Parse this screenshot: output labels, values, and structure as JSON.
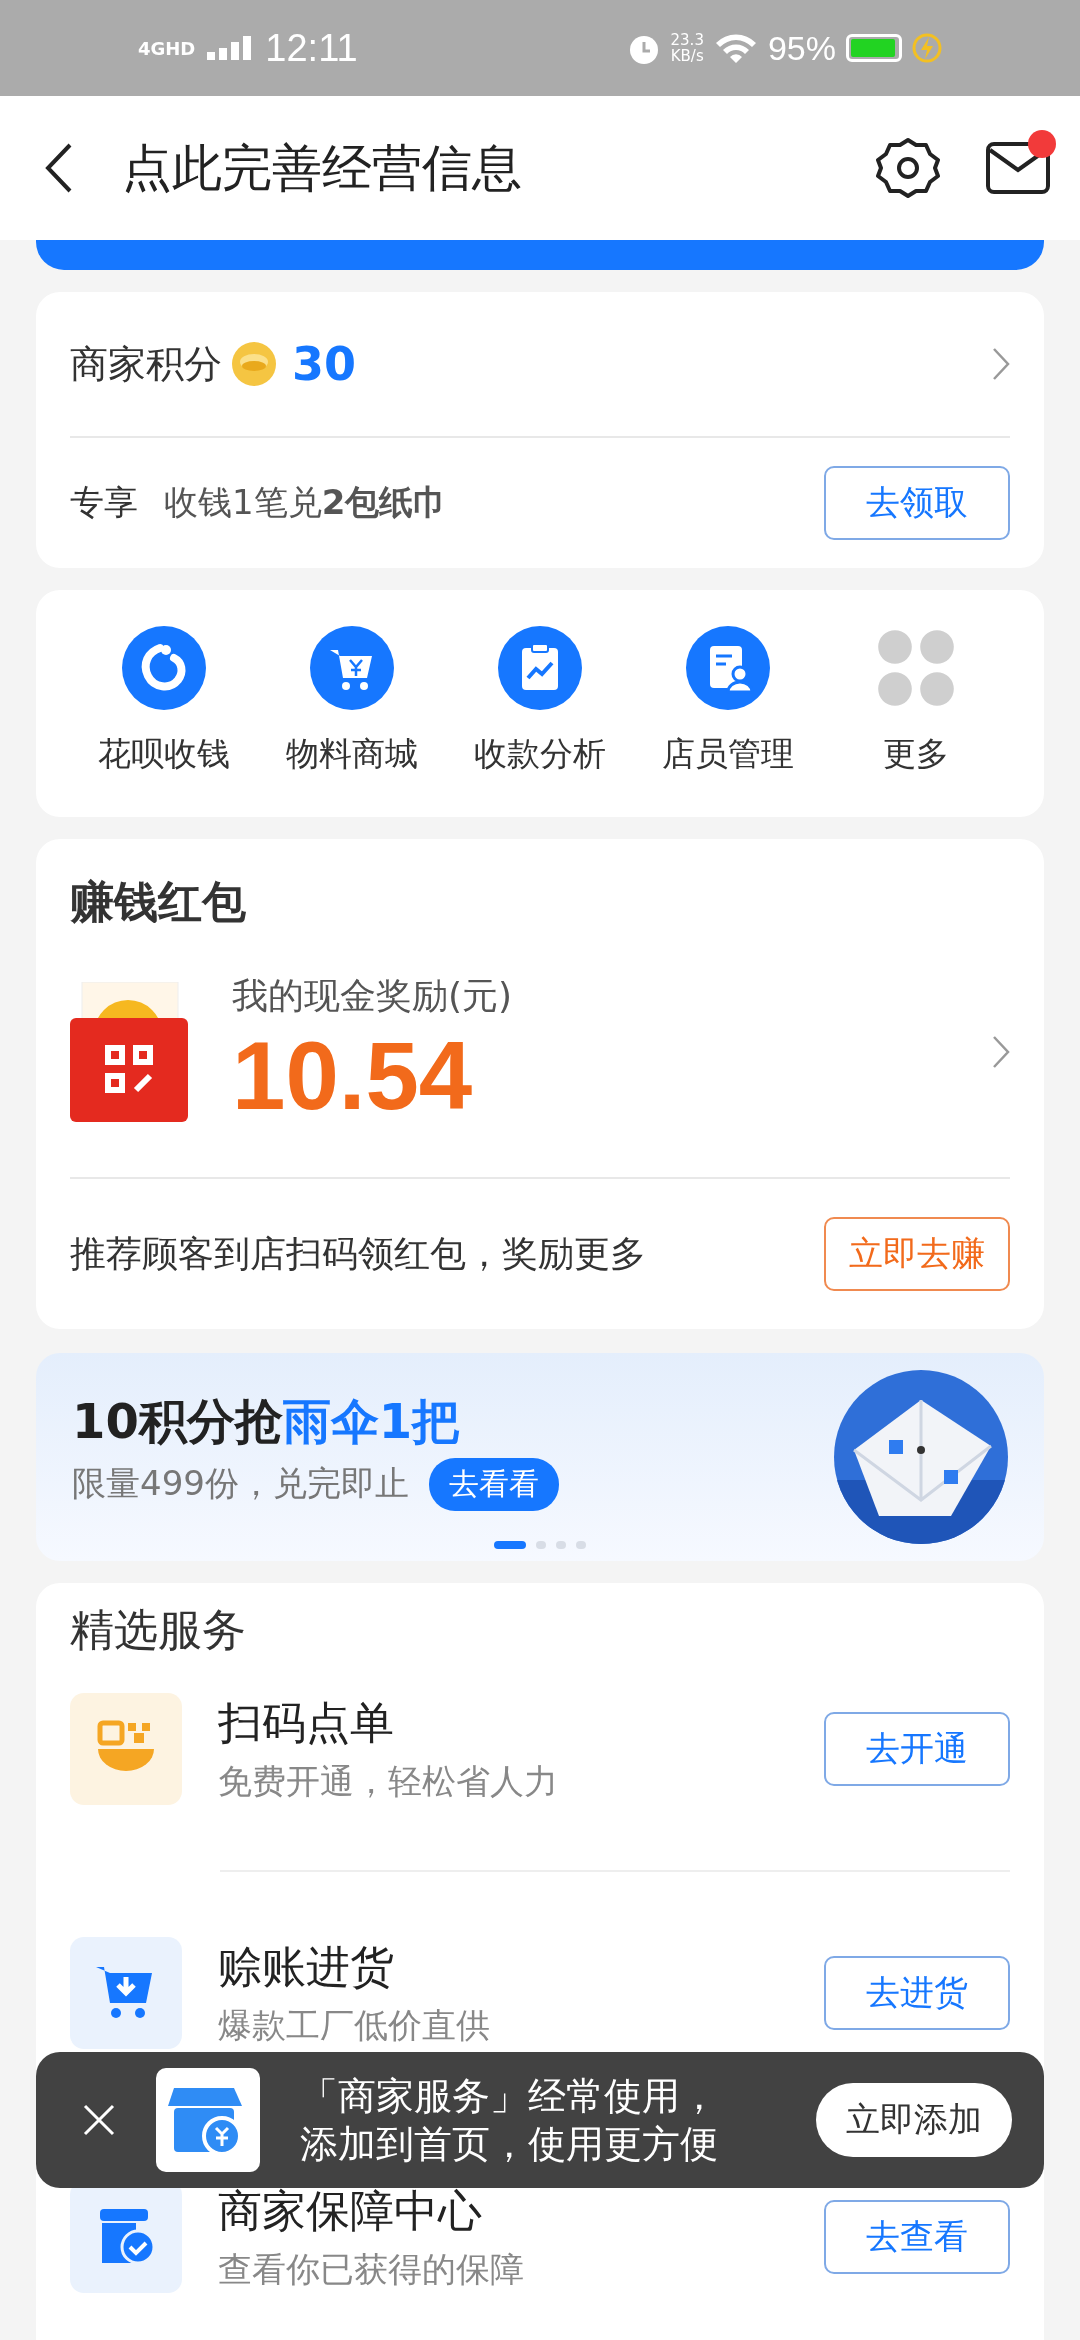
{
  "status_bar": {
    "network": "4GHD",
    "time": "12:11",
    "speed": "23.3",
    "speed_unit": "KB/s",
    "battery": "95%"
  },
  "header": {
    "title": "点此完善经营信息",
    "mail_unread": true
  },
  "points": {
    "label": "商家积分",
    "value": "30",
    "perk_tag": "专享",
    "perk_text": "收钱1笔兑**2包纸巾**",
    "button": "去领取"
  },
  "shortcuts": [
    {
      "kind": "flower",
      "label": "花呗收钱"
    },
    {
      "kind": "cart",
      "label": "物料商城"
    },
    {
      "kind": "chart",
      "label": "收款分析"
    },
    {
      "kind": "staff",
      "label": "店员管理"
    },
    {
      "kind": "more",
      "label": "更多"
    }
  ],
  "red_packet": {
    "title": "赚钱红包",
    "label": "我的现金奖励(元)",
    "amount": "10.54",
    "tip": "推荐顾客到店扫码领红包，奖励更多",
    "button": "立即去赚"
  },
  "banner": {
    "title_lead": "10积分抢",
    "title_highlight": "雨伞1把",
    "subtitle": "限量499份，兑完即止",
    "button": "去看看",
    "dots": [
      {
        "selected": true
      },
      {
        "selected": false
      },
      {
        "selected": false
      },
      {
        "selected": false
      }
    ]
  },
  "services": {
    "title": "精选服务",
    "items": [
      {
        "kind": "scan",
        "name": "扫码点单",
        "desc": "免费开通，轻松省人力",
        "button": "去开通"
      },
      {
        "kind": "stock",
        "name": "赊账进货",
        "desc": "爆款工厂低价直供",
        "button": "去进货"
      },
      {
        "kind": "shield",
        "name": "商家保障中心",
        "desc": "查看你已获得的保障",
        "button": "去查看"
      }
    ]
  },
  "toast": {
    "lines": [
      "「商家服务」经常使用，",
      "添加到首页，使用更方便"
    ],
    "button": "立即添加"
  }
}
